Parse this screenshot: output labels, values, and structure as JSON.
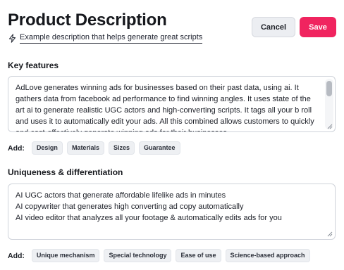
{
  "header": {
    "title": "Product Description",
    "helper_text": "Example description that helps generate great scripts",
    "helper_icon": "lightning-bolt-icon",
    "cancel_label": "Cancel",
    "save_label": "Save"
  },
  "colors": {
    "save_button": "#f0245f",
    "cancel_button": "#eceef2"
  },
  "key_features": {
    "label": "Key features",
    "value": "AdLove generates winning ads for businesses based on their past data, using ai. It gathers data from facebook ad performance to find winning angles. It uses state of the art ai to generate realistic UGC actors and high-converting scripts. It tags all your b roll and uses it to automatically edit your ads. All this combined allows customers to quickly and cost-effectively generate winning ads for their businesses.",
    "add_label": "Add:",
    "chips": [
      "Design",
      "Materials",
      "Sizes",
      "Guarantee"
    ]
  },
  "uniqueness": {
    "label": "Uniqueness & differentiation",
    "value": "AI UGC actors that generate affordable lifelike ads in minutes\nAI copywriter that generates high converting ad copy automatically\nAI video editor that analyzes all your footage & automatically edits ads for you",
    "add_label": "Add:",
    "chips": [
      "Unique mechanism",
      "Special technology",
      "Ease of use",
      "Science-based approach"
    ]
  }
}
